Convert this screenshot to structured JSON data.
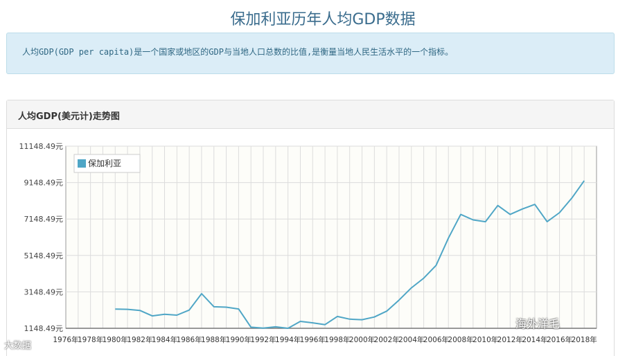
{
  "page": {
    "title": "保加利亚历年人均GDP数据"
  },
  "info": {
    "text": "人均GDP(GDP per capita)是一个国家或地区的GDP与当地人口总数的比值,是衡量当地人民生活水平的一个指标。"
  },
  "panel": {
    "title": "人均GDP(美元计)走势图"
  },
  "watermarks": {
    "wechat": "海外洋毛",
    "weibo": "大数据"
  },
  "colors": {
    "line": "#4fa6c6",
    "plot_bg": "#fdfdf9",
    "grid": "#dcdcdc",
    "title": "#3a6c8d"
  },
  "chart_data": {
    "type": "line",
    "title": "人均GDP(美元计)走势图",
    "xlabel": "",
    "ylabel": "",
    "x_ticks": [
      "1976年",
      "1978年",
      "1980年",
      "1982年",
      "1984年",
      "1986年",
      "1988年",
      "1990年",
      "1992年",
      "1994年",
      "1996年",
      "1998年",
      "2000年",
      "2002年",
      "2004年",
      "2006年",
      "2008年",
      "2010年",
      "2012年",
      "2014年",
      "2016年",
      "2018年"
    ],
    "y_ticks": [
      "1148.49元",
      "3148.49元",
      "5148.49元",
      "7148.49元",
      "9148.49元",
      "11148.49元"
    ],
    "xlim": [
      1976,
      2019
    ],
    "ylim": [
      1148.49,
      11148.49
    ],
    "legend": {
      "position": "top-left"
    },
    "grid": true,
    "series": [
      {
        "name": "保加利亚",
        "x": [
          1980,
          1981,
          1982,
          1983,
          1984,
          1985,
          1986,
          1987,
          1988,
          1989,
          1990,
          1991,
          1992,
          1993,
          1994,
          1995,
          1996,
          1997,
          1998,
          1999,
          2000,
          2001,
          2002,
          2003,
          2004,
          2005,
          2006,
          2007,
          2008,
          2009,
          2010,
          2011,
          2012,
          2013,
          2014,
          2015,
          2016,
          2017,
          2018
        ],
        "y": [
          2200,
          2190,
          2130,
          1830,
          1920,
          1870,
          2150,
          3050,
          2330,
          2310,
          2210,
          1210,
          1160,
          1230,
          1150,
          1530,
          1450,
          1350,
          1800,
          1650,
          1620,
          1770,
          2090,
          2700,
          3370,
          3900,
          4600,
          6100,
          7400,
          7100,
          7000,
          7890,
          7400,
          7700,
          7950,
          7000,
          7500,
          8300,
          9250
        ]
      }
    ]
  }
}
